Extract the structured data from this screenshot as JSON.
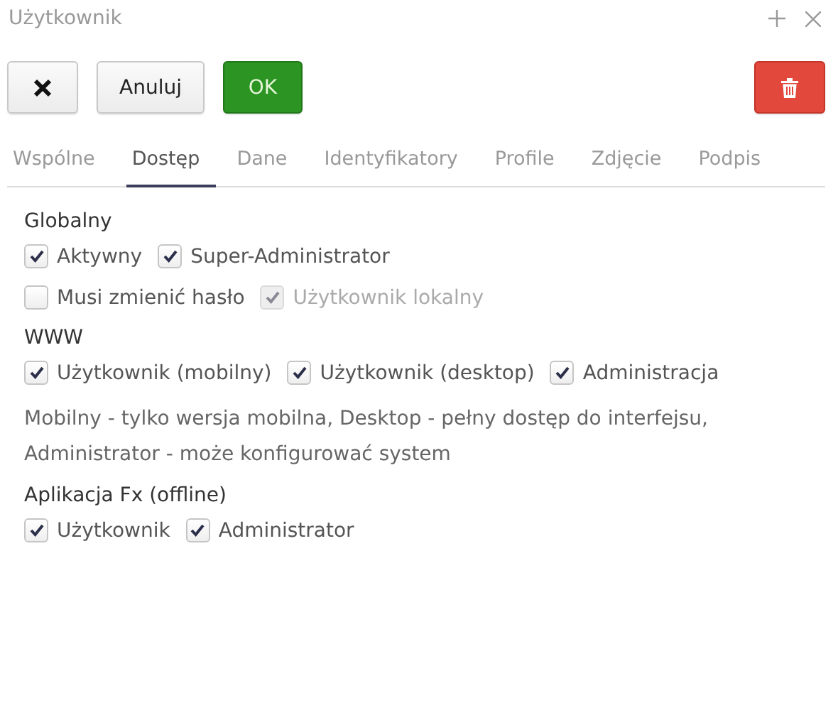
{
  "window": {
    "title": "Użytkownik"
  },
  "toolbar": {
    "cancel": "Anuluj",
    "ok": "OK"
  },
  "tabs": [
    {
      "label": "Wspólne",
      "selected": false
    },
    {
      "label": "Dostęp",
      "selected": true
    },
    {
      "label": "Dane",
      "selected": false
    },
    {
      "label": "Identyfikatory",
      "selected": false
    },
    {
      "label": "Profile",
      "selected": false
    },
    {
      "label": "Zdjęcie",
      "selected": false
    },
    {
      "label": "Podpis",
      "selected": false
    }
  ],
  "sections": [
    {
      "title": "Globalny",
      "rows": [
        [
          {
            "label": "Aktywny",
            "checked": true,
            "disabled": false
          },
          {
            "label": "Super-Administrator",
            "checked": true,
            "disabled": false
          }
        ],
        [
          {
            "label": "Musi zmienić hasło",
            "checked": false,
            "disabled": false
          },
          {
            "label": "Użytkownik lokalny",
            "checked": true,
            "disabled": true
          }
        ]
      ]
    },
    {
      "title": "WWW",
      "rows": [
        [
          {
            "label": "Użytkownik (mobilny)",
            "checked": true,
            "disabled": false
          },
          {
            "label": "Użytkownik (desktop)",
            "checked": true,
            "disabled": false
          },
          {
            "label": "Administracja",
            "checked": true,
            "disabled": false
          }
        ]
      ],
      "note": "Mobilny - tylko wersja mobilna, Desktop - pełny dostęp do interfejsu, Administrator - może konfigurować system"
    },
    {
      "title": "Aplikacja Fx (offline)",
      "rows": [
        [
          {
            "label": "Użytkownik",
            "checked": true,
            "disabled": false
          },
          {
            "label": "Administrator",
            "checked": true,
            "disabled": false
          }
        ]
      ]
    }
  ]
}
